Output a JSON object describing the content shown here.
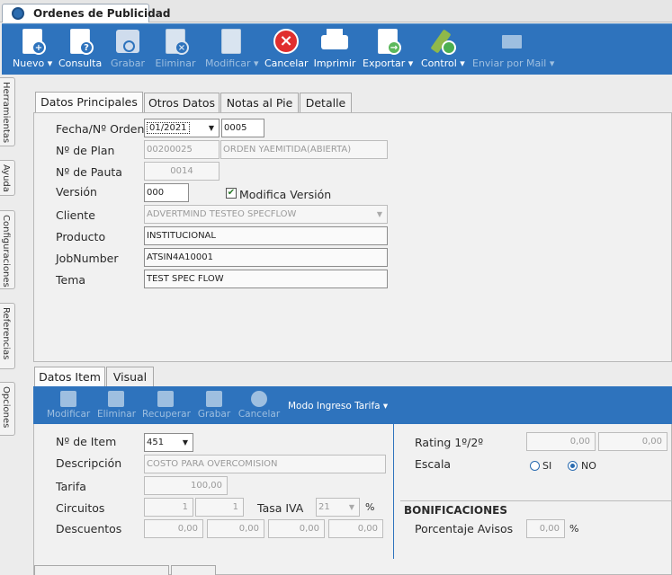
{
  "window": {
    "tab_title": "Ordenes de Publicidad"
  },
  "toolbar": {
    "nuevo": "Nuevo",
    "consulta": "Consulta",
    "grabar": "Grabar",
    "eliminar": "Eliminar",
    "modificar": "Modificar",
    "cancelar": "Cancelar",
    "imprimir": "Imprimir",
    "exportar": "Exportar",
    "control": "Control",
    "enviar_mail": "Enviar por Mail"
  },
  "sidebar": {
    "items": [
      "Herramientas",
      "Ayuda",
      "Configuraciones",
      "Referencias",
      "Opciones"
    ]
  },
  "main_tabs": [
    "Datos Principales",
    "Otros Datos",
    "Notas al Pie",
    "Detalle"
  ],
  "form": {
    "fecha_label": "Fecha/Nº Orden",
    "fecha_value": "01/2021",
    "orden_value": "0005",
    "plan_label": "Nº de Plan",
    "plan_value": "00200025",
    "plan_status": "ORDEN YAEMITIDA(ABIERTA)",
    "pauta_label": "Nº de Pauta",
    "pauta_value": "0014",
    "version_label": "Versión",
    "version_value": "000",
    "modifica_version_label": "Modifica Versión",
    "modifica_version_checked": true,
    "cliente_label": "Cliente",
    "cliente_value": "ADVERTMIND TESTEO SPECFLOW",
    "producto_label": "Producto",
    "producto_value": "INSTITUCIONAL",
    "jobnumber_label": "JobNumber",
    "jobnumber_value": "ATSIN4A10001",
    "tema_label": "Tema",
    "tema_value": "TEST SPEC FLOW"
  },
  "item_tabs": [
    "Datos Item",
    "Visual"
  ],
  "item_toolbar": {
    "modificar": "Modificar",
    "eliminar": "Eliminar",
    "recuperar": "Recuperar",
    "grabar": "Grabar",
    "cancelar": "Cancelar",
    "modo_ingreso": "Modo Ingreso Tarifa"
  },
  "item": {
    "nro_item_label": "Nº de Item",
    "nro_item_value": "451",
    "descripcion_label": "Descripción",
    "descripcion_value": "COSTO PARA OVERCOMISION",
    "tarifa_label": "Tarifa",
    "tarifa_value": "100,00",
    "circuitos_label": "Circuitos",
    "circuitos_1": "1",
    "circuitos_2": "1",
    "tasa_iva_label": "Tasa IVA",
    "tasa_iva_value": "21",
    "tasa_iva_unit": "%",
    "descuentos_label": "Descuentos",
    "descuentos_values": [
      "0,00",
      "0,00",
      "0,00",
      "0,00"
    ],
    "rating_label": "Rating 1º/2º",
    "rating_1": "0,00",
    "rating_2": "0,00",
    "escala_label": "Escala",
    "escala_si": "SI",
    "escala_no": "NO",
    "escala_selected": "NO",
    "bonificaciones_title": "BONIFICACIONES",
    "porcentaje_avisos_label": "Porcentaje Avisos",
    "porcentaje_avisos_value": "0,00",
    "porcentaje_unit": "%"
  }
}
